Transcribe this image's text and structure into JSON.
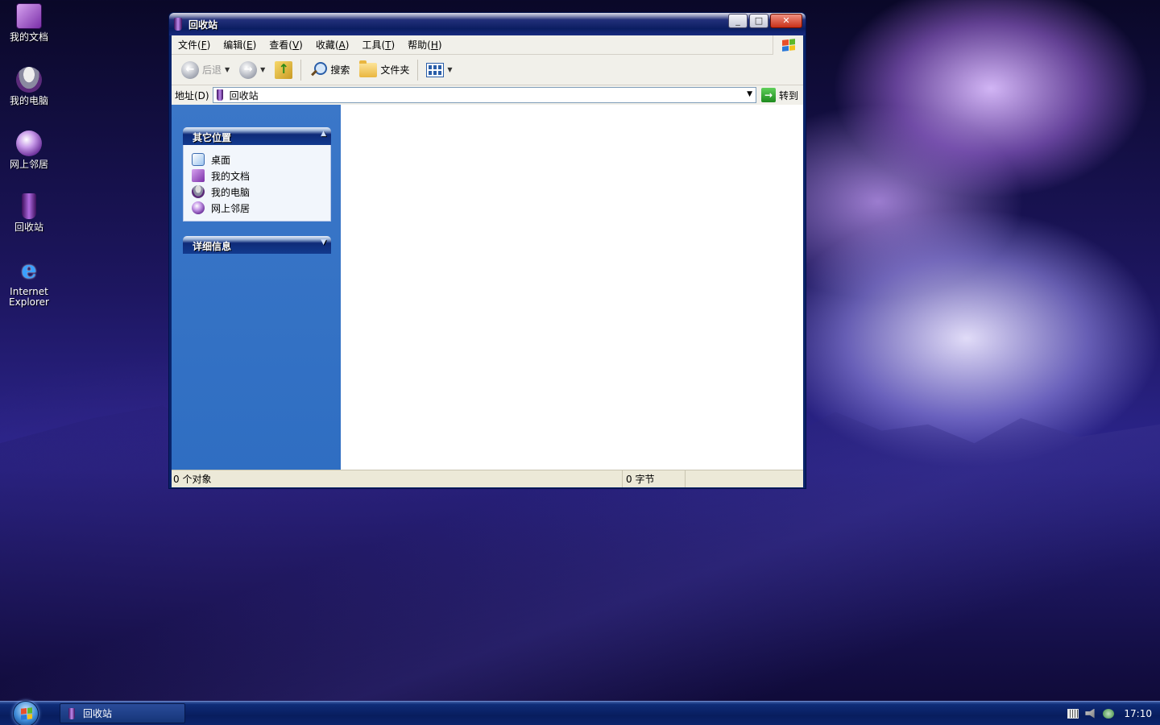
{
  "desktop": {
    "icons": [
      {
        "label": "我的文档"
      },
      {
        "label": "我的电脑"
      },
      {
        "label": "网上邻居"
      },
      {
        "label": "回收站"
      },
      {
        "label": "Internet Explorer"
      }
    ]
  },
  "window": {
    "title": "回收站",
    "controls": {
      "minimize": "_",
      "maximize": "□",
      "close": "✕"
    },
    "menu": [
      {
        "label": "文件(",
        "key": "F",
        "end": ")"
      },
      {
        "label": "编辑(",
        "key": "E",
        "end": ")"
      },
      {
        "label": "查看(",
        "key": "V",
        "end": ")"
      },
      {
        "label": "收藏(",
        "key": "A",
        "end": ")"
      },
      {
        "label": "工具(",
        "key": "T",
        "end": ")"
      },
      {
        "label": "帮助(",
        "key": "H",
        "end": ")"
      }
    ],
    "toolbar": {
      "back": "后退",
      "search": "搜索",
      "folders": "文件夹"
    },
    "address": {
      "label": "地址(D)",
      "value": "回收站",
      "go": "转到"
    },
    "sidebar": {
      "other_places": {
        "title": "其它位置",
        "items": [
          "桌面",
          "我的文档",
          "我的电脑",
          "网上邻居"
        ]
      },
      "details": {
        "title": "详细信息"
      }
    },
    "status": {
      "objects": "0 个对象",
      "size": "0 字节"
    }
  },
  "taskbar": {
    "active_item": "回收站",
    "clock": "17:10"
  },
  "colors": {
    "sidebar_bg": "#2f6ec2",
    "titlebar": "#0b1e62",
    "taskbar": "#081d5e"
  }
}
